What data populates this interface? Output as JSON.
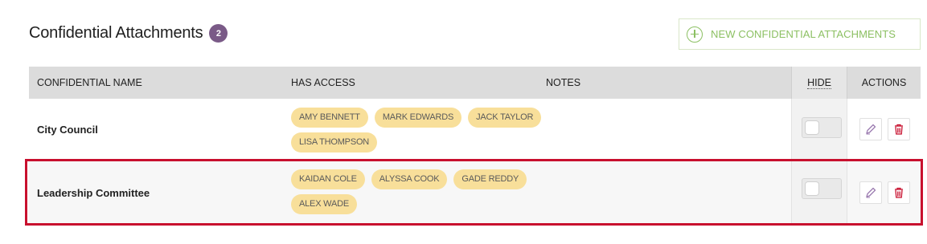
{
  "header": {
    "title": "Confidential Attachments",
    "count": "2"
  },
  "new_button": {
    "label": "NEW CONFIDENTIAL ATTACHMENTS"
  },
  "columns": {
    "name": "CONFIDENTIAL NAME",
    "access": "HAS ACCESS",
    "notes": "NOTES",
    "hide": "HIDE",
    "actions": "ACTIONS"
  },
  "rows": [
    {
      "name": "City Council",
      "access": [
        "AMY BENNETT",
        "MARK EDWARDS",
        "JACK TAYLOR",
        "LISA THOMPSON"
      ],
      "hidden": false
    },
    {
      "name": "Leadership Committee",
      "access": [
        "KAIDAN COLE",
        "ALYSSA COOK",
        "GADE REDDY",
        "ALEX WADE"
      ],
      "hidden": false
    }
  ],
  "icons": {
    "add": "plus-circle-icon",
    "edit": "pencil-icon",
    "delete": "trash-icon"
  },
  "colors": {
    "accent_green": "#8cc063",
    "badge": "#7a5a87",
    "chip": "#f8df9a",
    "delete_red": "#c8102e",
    "edit_purple": "#9b7bb0",
    "highlight": "#c8102e"
  }
}
